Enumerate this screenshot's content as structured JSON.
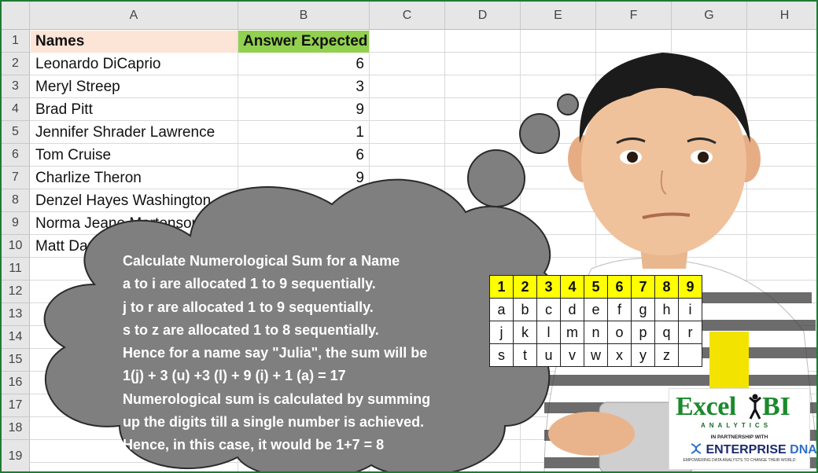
{
  "columns": [
    "A",
    "B",
    "C",
    "D",
    "E",
    "F",
    "G",
    "H"
  ],
  "rows": [
    "1",
    "2",
    "3",
    "4",
    "5",
    "6",
    "7",
    "8",
    "9",
    "10",
    "11",
    "12",
    "13",
    "14",
    "15",
    "16",
    "17",
    "18",
    "19"
  ],
  "header": {
    "names": "Names",
    "answer": "Answer Expected"
  },
  "names": [
    "Leonardo DiCaprio",
    "Meryl Streep",
    "Brad Pitt",
    "Jennifer Shrader Lawrence",
    "Tom Cruise",
    "Charlize Theron",
    "Denzel Hayes Washington",
    "Norma Jeane Mortenson",
    "Matt Damon"
  ],
  "answers": [
    "6",
    "3",
    "9",
    "1",
    "6",
    "9"
  ],
  "cloud_lines": [
    "Calculate Numerological Sum for a Name",
    "a to i are allocated 1 to 9 sequentially.",
    "j to r are allocated 1 to 9 sequentially.",
    "s to z are allocated 1 to 8 sequentially.",
    "Hence for a name say \"Julia\", the sum will be",
    "1(j) + 3 (u) +3 (l) + 9 (i) + 1 (a) = 17",
    "Numerological sum is calculated by summing",
    "up the digits till a single number is achieved.",
    "Hence, in this case, it would be 1+7 = 8"
  ],
  "letter_table": {
    "digits": [
      "1",
      "2",
      "3",
      "4",
      "5",
      "6",
      "7",
      "8",
      "9"
    ],
    "row1": [
      "a",
      "b",
      "c",
      "d",
      "e",
      "f",
      "g",
      "h",
      "i"
    ],
    "row2": [
      "j",
      "k",
      "l",
      "m",
      "n",
      "o",
      "p",
      "q",
      "r"
    ],
    "row3": [
      "s",
      "t",
      "u",
      "v",
      "w",
      "x",
      "y",
      "z",
      ""
    ]
  },
  "logo": {
    "excel": "Excel",
    "bi": "BI",
    "analytics": "ANALYTICS",
    "partnership": "IN PARTNERSHIP WITH",
    "enterprise": "ENTERPRISE",
    "dna": "DNA",
    "tagline": "EMPOWERING DATA ANALYSTS TO CHANGE THEIR WORLD"
  },
  "colors": {
    "names_header_bg": "#fce4d6",
    "answer_header_bg": "#92d050",
    "table_header_bg": "#ffff00",
    "cloud": "#7f7f7f",
    "brand": "#1a8a2c"
  }
}
